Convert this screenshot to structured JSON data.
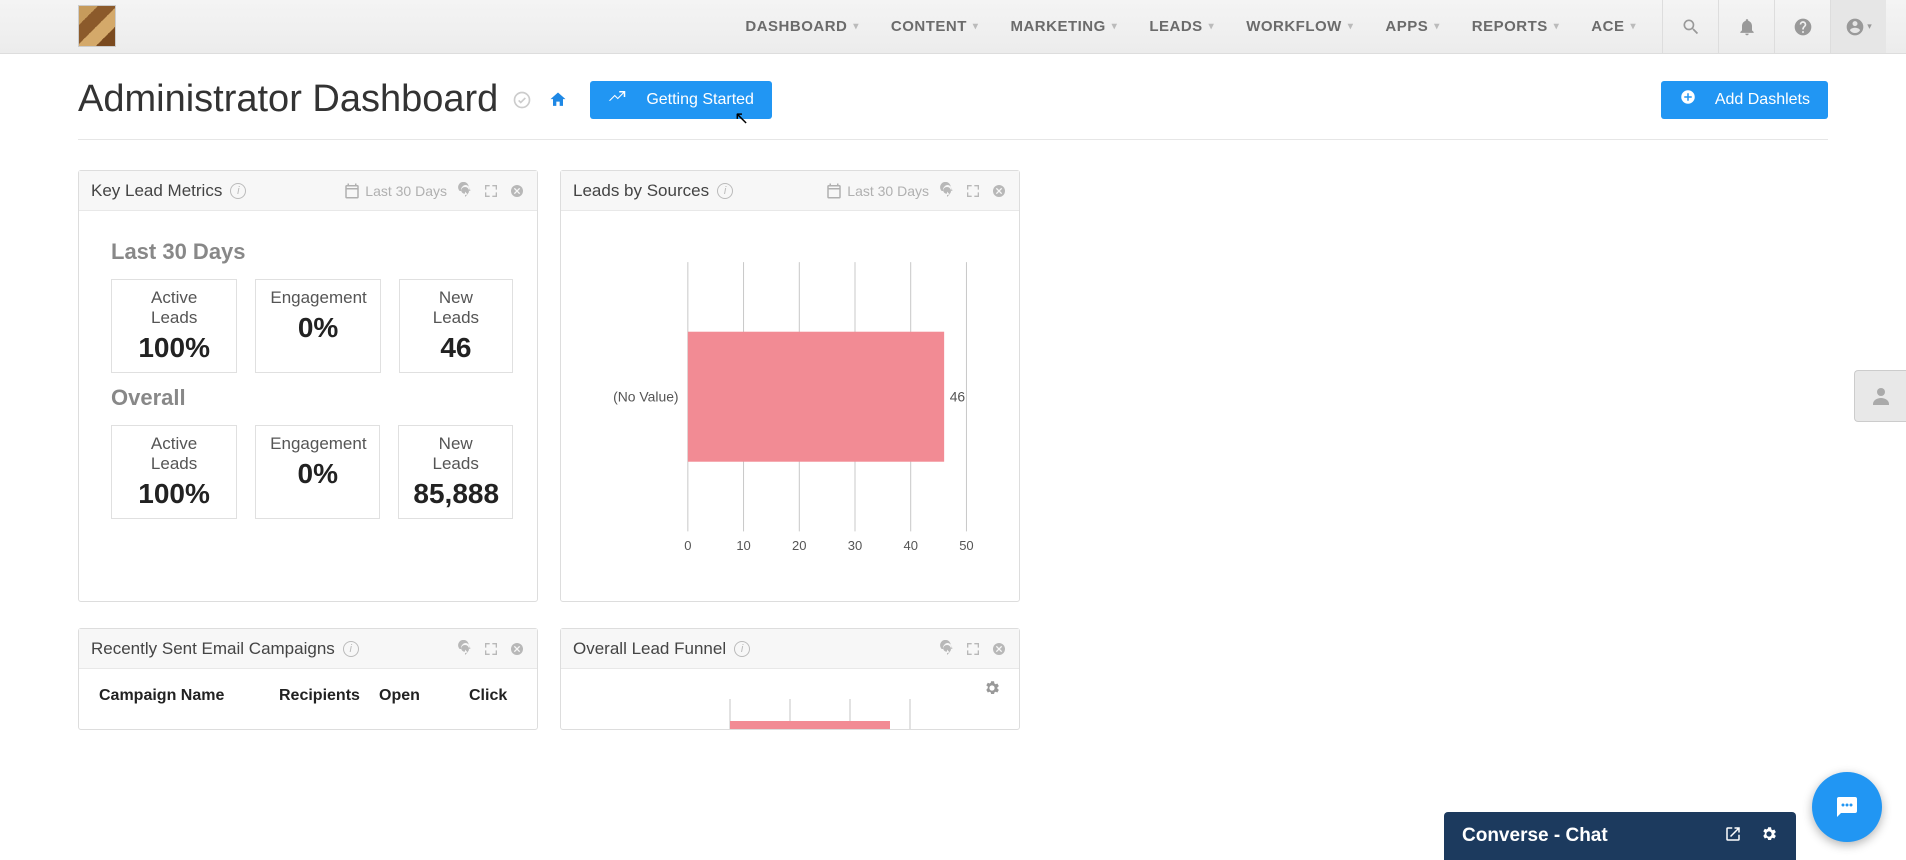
{
  "nav": {
    "items": [
      {
        "label": "DASHBOARD"
      },
      {
        "label": "CONTENT"
      },
      {
        "label": "MARKETING"
      },
      {
        "label": "LEADS"
      },
      {
        "label": "WORKFLOW"
      },
      {
        "label": "APPS"
      },
      {
        "label": "REPORTS"
      },
      {
        "label": "ACE"
      }
    ]
  },
  "header": {
    "title": "Administrator Dashboard",
    "getting_started": "Getting Started",
    "add_dashlets": "Add Dashlets"
  },
  "dashlets": {
    "key_lead_metrics": {
      "title": "Key Lead Metrics",
      "range": "Last 30 Days",
      "sections": [
        {
          "label": "Last 30 Days",
          "metrics": [
            {
              "label": "Active Leads",
              "value": "100%"
            },
            {
              "label": "Engagement",
              "value": "0%"
            },
            {
              "label": "New Leads",
              "value": "46"
            }
          ]
        },
        {
          "label": "Overall",
          "metrics": [
            {
              "label": "Active Leads",
              "value": "100%"
            },
            {
              "label": "Engagement",
              "value": "0%"
            },
            {
              "label": "New Leads",
              "value": "85,888"
            }
          ]
        }
      ]
    },
    "leads_by_sources": {
      "title": "Leads by Sources",
      "range": "Last 30 Days"
    },
    "recent_campaigns": {
      "title": "Recently Sent Email Campaigns",
      "columns": [
        "Campaign Name",
        "Recipients",
        "Open",
        "Click"
      ]
    },
    "lead_funnel": {
      "title": "Overall Lead Funnel"
    }
  },
  "chart_data": {
    "type": "bar",
    "orientation": "horizontal",
    "categories": [
      "(No Value)"
    ],
    "values": [
      46
    ],
    "series_label": "(No Value)",
    "value_label": "46",
    "xlim": [
      0,
      50
    ],
    "ticks": [
      0,
      10,
      20,
      30,
      40,
      50
    ],
    "tick_labels": [
      "0",
      "10",
      "20",
      "30",
      "40",
      "50"
    ],
    "bar_color": "#f28b94"
  },
  "chat": {
    "title": "Converse - Chat"
  }
}
